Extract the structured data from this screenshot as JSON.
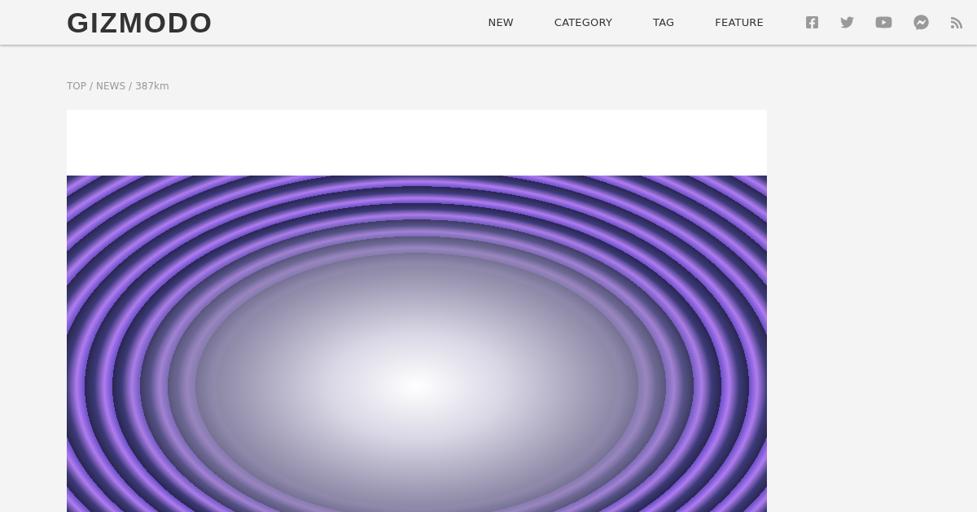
{
  "header": {
    "logo": "GIZMODO",
    "nav": [
      {
        "label": "NEW"
      },
      {
        "label": "CATEGORY"
      },
      {
        "label": "TAG"
      },
      {
        "label": "FEATURE"
      }
    ]
  },
  "breadcrumb": {
    "items": [
      "TOP",
      "NEWS",
      "387km"
    ],
    "separators": [
      "/",
      "/"
    ]
  }
}
